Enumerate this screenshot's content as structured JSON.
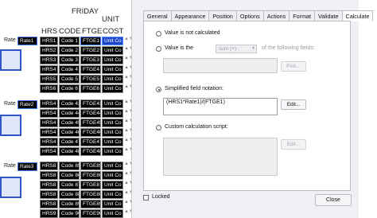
{
  "form": {
    "day": "FRIDAY",
    "unit_top": "UNIT",
    "headers": {
      "hrs": "HRS",
      "code": "CODE",
      "ftge": "FTGE",
      "cost": "COST"
    },
    "rate_labels": {
      "r1": "Rate",
      "r2": "Rate",
      "r3": "Rate"
    },
    "rate_fields": {
      "r1": "Rate1",
      "r2": "Rate2",
      "r3": "Rate3"
    },
    "rows": [
      {
        "hrs": "HRS1",
        "code": "Code 1",
        "ftge": "FTGE1",
        "uc": "Unit Co"
      },
      {
        "hrs": "HRS2",
        "code": "Code 2",
        "ftge": "FTGE2",
        "uc": "Unit Co"
      },
      {
        "hrs": "HRS3",
        "code": "Code 3",
        "ftge": "FTGE3",
        "uc": "Unit Co"
      },
      {
        "hrs": "HRS4",
        "code": "Code 4",
        "ftge": "FTGE4",
        "uc": "Unit Co"
      },
      {
        "hrs": "HRS5",
        "code": "Code 5",
        "ftge": "FTGE5",
        "uc": "Unit Co"
      },
      {
        "hrs": "HRS6",
        "code": "Code 6",
        "ftge": "FTGE6",
        "uc": "Unit Co"
      },
      {
        "hrs": "HRS4",
        "code": "Code 43",
        "ftge": "FTGE43",
        "uc": "Unit Co"
      },
      {
        "hrs": "HRS4",
        "code": "Code 44",
        "ftge": "FTGE44",
        "uc": "Unit Co"
      },
      {
        "hrs": "HRS4",
        "code": "Code 45",
        "ftge": "FTGE45",
        "uc": "Unit Co"
      },
      {
        "hrs": "HRS4",
        "code": "Code 46",
        "ftge": "FTGE46",
        "uc": "Unit Co"
      },
      {
        "hrs": "HRS4",
        "code": "Code 47",
        "ftge": "FTGE47",
        "uc": "Unit Co"
      },
      {
        "hrs": "HRS4",
        "code": "Code 48",
        "ftge": "FTGE48",
        "uc": "Unit Co"
      },
      {
        "hrs": "HRS8",
        "code": "Code 85",
        "ftge": "FTGE85",
        "uc": "Unit Co"
      },
      {
        "hrs": "HRS8",
        "code": "Code 86",
        "ftge": "FTGE86",
        "uc": "Unit Co"
      },
      {
        "hrs": "HRS8",
        "code": "Code 87",
        "ftge": "FTGE87",
        "uc": "Unit Co"
      },
      {
        "hrs": "HRS8",
        "code": "Code 88",
        "ftge": "FTGE88",
        "uc": "Unit Co"
      },
      {
        "hrs": "HRS8",
        "code": "Code 89",
        "ftge": "FTGE89",
        "uc": "Unit Co"
      },
      {
        "hrs": "HRS9",
        "code": "Code 90",
        "ftge": "FTGE90",
        "uc": "Unit Co"
      }
    ],
    "spinner_glyph": "▲▼"
  },
  "dialog": {
    "tabs": [
      "General",
      "Appearance",
      "Position",
      "Options",
      "Actions",
      "Format",
      "Validate",
      "Calculate"
    ],
    "active_tab": "Calculate",
    "calc": {
      "opt_none": "Value is not calculated",
      "opt_value": "Value is the",
      "op_select": "sum (+)",
      "of_following": "of the following fields:",
      "pick_button": "Pick...",
      "opt_simplified": "Simplified field notation:",
      "simplified_expr": "(HRS1*Rate1)/(FTGE1)",
      "edit_button": "Edit...",
      "opt_custom": "Custom calculation script:",
      "custom_edit_button": "Edit..."
    },
    "locked_label": "Locked",
    "close_button": "Close"
  }
}
